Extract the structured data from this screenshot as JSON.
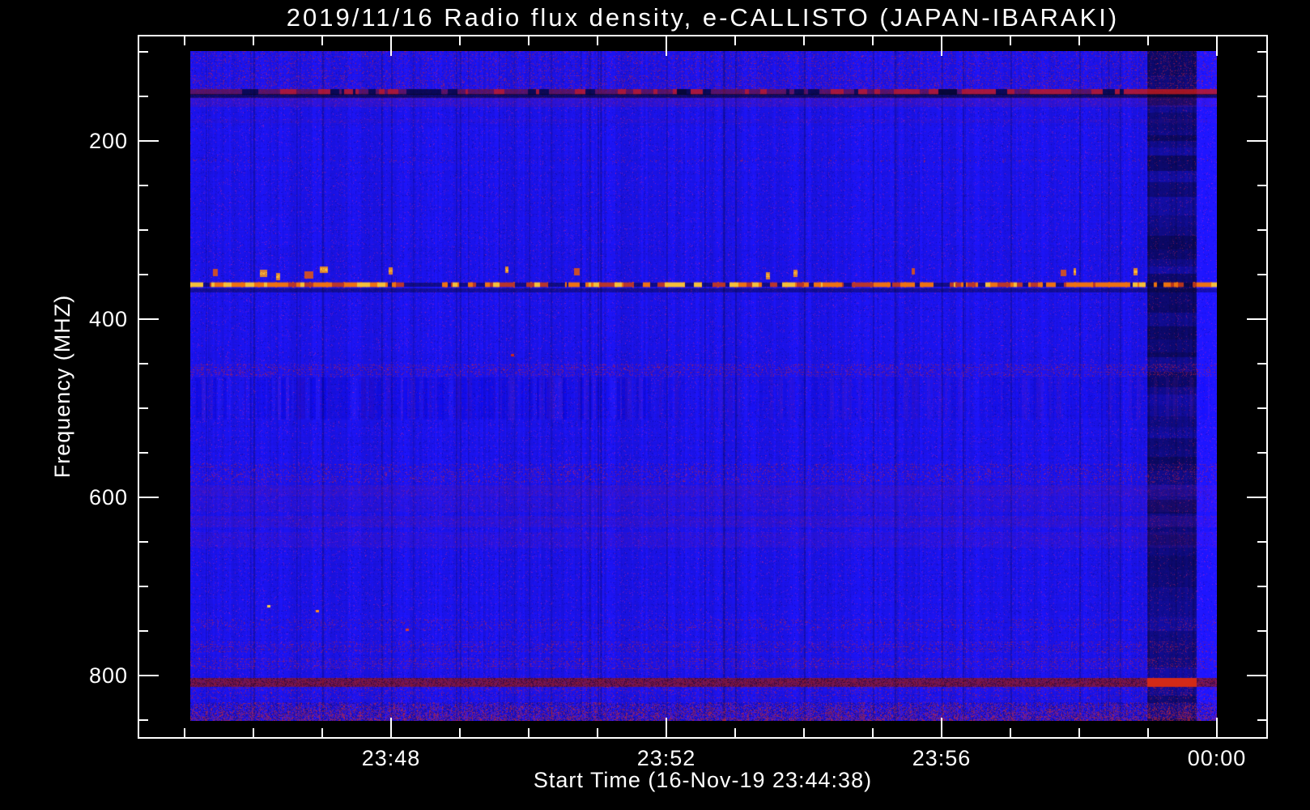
{
  "chart_data": {
    "type": "heatmap",
    "title": "2019/11/16  Radio flux density, e-CALLISTO (JAPAN-IBARAKI)",
    "xlabel": "Start Time (16-Nov-19 23:44:38)",
    "ylabel": "Frequency (MHZ)",
    "start_time": "23:44:38",
    "start_date": "16-Nov-19",
    "x_axis": {
      "major": [
        {
          "label": "23:48",
          "min_before_midnight": 12
        },
        {
          "label": "23:52",
          "min_before_midnight": 8
        },
        {
          "label": "23:56",
          "min_before_midnight": 4
        },
        {
          "label": "00:00",
          "min_before_midnight": 0
        }
      ],
      "minor_min_before_midnight": [
        15,
        14,
        13,
        11,
        10,
        9,
        7,
        6,
        5,
        3,
        2,
        1
      ]
    },
    "y_axis": {
      "major": [
        200,
        400,
        600,
        800
      ],
      "minor": [
        100,
        150,
        250,
        300,
        350,
        450,
        500,
        550,
        650,
        700,
        750,
        850
      ],
      "units": "MHz"
    },
    "freq_range_mhz": [
      100,
      851
    ],
    "palette": {
      "background": "#000000",
      "frame": "#ffffff",
      "text": "#ffffff",
      "base_blue": "#1b13ea",
      "speckle_red": "#b91e3c",
      "purple": "#6e1496",
      "dark": "#050528",
      "rfi_red": "#c81414",
      "orange": "#f07010",
      "yellow": "#ffcc3c"
    },
    "features": {
      "horizontal_bands": [
        {
          "f0": 100,
          "f1": 128,
          "style": "speckle",
          "intensity": 0.3
        },
        {
          "f0": 128,
          "f1": 143,
          "style": "speckle",
          "intensity": 0.45
        },
        {
          "f0": 143,
          "f1": 148,
          "style": "red_line",
          "intensity": 0.85
        },
        {
          "f0": 148,
          "f1": 152,
          "style": "dark",
          "intensity": 0.75
        },
        {
          "f0": 152,
          "f1": 162,
          "style": "purple",
          "intensity": 0.55
        },
        {
          "f0": 176,
          "f1": 180,
          "style": "purple",
          "intensity": 0.25
        },
        {
          "f0": 221,
          "f1": 225,
          "style": "speckle",
          "intensity": 0.18
        },
        {
          "f0": 342,
          "f1": 358,
          "style": "orange_dots",
          "intensity": 0.5
        },
        {
          "f0": 359,
          "f1": 365,
          "style": "orange_line",
          "intensity": 1.0
        },
        {
          "f0": 366,
          "f1": 370,
          "style": "dark",
          "intensity": 0.45
        },
        {
          "f0": 451,
          "f1": 465,
          "style": "speckle",
          "intensity": 0.55
        },
        {
          "f0": 466,
          "f1": 513,
          "style": "striation",
          "intensity": 0.6
        },
        {
          "f0": 563,
          "f1": 585,
          "style": "speckle",
          "intensity": 0.4
        },
        {
          "f0": 587,
          "f1": 599,
          "style": "purple",
          "intensity": 0.5
        },
        {
          "f0": 601,
          "f1": 616,
          "style": "purple",
          "intensity": 0.3
        },
        {
          "f0": 622,
          "f1": 634,
          "style": "purple",
          "intensity": 0.45
        },
        {
          "f0": 640,
          "f1": 656,
          "style": "purple",
          "intensity": 0.35
        },
        {
          "f0": 737,
          "f1": 749,
          "style": "speckle",
          "intensity": 0.3
        },
        {
          "f0": 763,
          "f1": 775,
          "style": "speckle",
          "intensity": 0.45
        },
        {
          "f0": 781,
          "f1": 793,
          "style": "speckle",
          "intensity": 0.5
        },
        {
          "f0": 804,
          "f1": 813,
          "style": "red_line_strong",
          "intensity": 0.9
        },
        {
          "f0": 814,
          "f1": 827,
          "style": "speckle",
          "intensity": 0.35
        },
        {
          "f0": 831,
          "f1": 851,
          "style": "noise_heavy",
          "intensity": 0.8
        }
      ],
      "vertical_features": [
        {
          "x0_frac": 0.932,
          "x1_frac": 0.98,
          "type": "dark_column"
        },
        {
          "x0_frac": 0.98,
          "x1_frac": 1.0,
          "type": "bright_column"
        }
      ],
      "redline_gaps_frac": [
        [
          0.474,
          0.483
        ],
        [
          0.729,
          0.746
        ]
      ],
      "spots": [
        {
          "x_frac": 0.075,
          "f": 722,
          "color": [
            255,
            205,
            70
          ]
        },
        {
          "x_frac": 0.122,
          "f": 727,
          "color": [
            255,
            140,
            30
          ]
        },
        {
          "x_frac": 0.312,
          "f": 440,
          "color": [
            200,
            40,
            30
          ]
        },
        {
          "x_frac": 0.21,
          "f": 748,
          "color": [
            220,
            60,
            40
          ]
        }
      ]
    }
  }
}
